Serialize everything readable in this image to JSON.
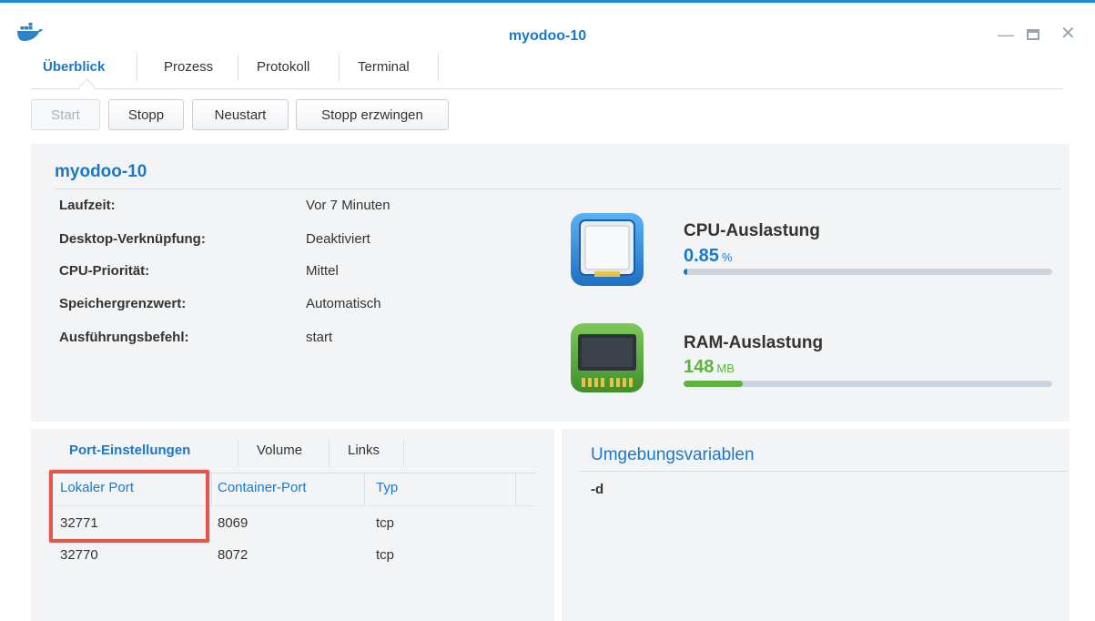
{
  "window": {
    "title": "myodoo-10",
    "app_icon": "docker-whale-icon",
    "controls": [
      "minimize-icon",
      "maximize-icon",
      "close-icon"
    ]
  },
  "tabs": [
    {
      "label": "Überblick",
      "active": true
    },
    {
      "label": "Prozess",
      "active": false
    },
    {
      "label": "Protokoll",
      "active": false
    },
    {
      "label": "Terminal",
      "active": false
    }
  ],
  "toolbar": {
    "start": "Start",
    "stop": "Stopp",
    "restart": "Neustart",
    "force_stop": "Stopp erzwingen"
  },
  "container": {
    "name": "myodoo-10",
    "details": [
      {
        "label": "Laufzeit:",
        "value": "Vor 7 Minuten"
      },
      {
        "label": "Desktop-Verknüpfung:",
        "value": "Deaktiviert"
      },
      {
        "label": "CPU-Priorität:",
        "value": "Mittel"
      },
      {
        "label": "Speichergrenzwert:",
        "value": "Automatisch"
      },
      {
        "label": "Ausführungsbefehl:",
        "value": "start"
      }
    ]
  },
  "metrics": {
    "cpu": {
      "title": "CPU-Auslastung",
      "value": "0.85",
      "unit": "%",
      "usage_fraction": 0.0085,
      "color": "#1b78c9"
    },
    "ram": {
      "title": "RAM-Auslastung",
      "value": "148",
      "unit": "MB",
      "usage_fraction": 0.16,
      "color": "#5cb33e"
    }
  },
  "ports": {
    "tabs": [
      {
        "label": "Port-Einstellungen",
        "active": true
      },
      {
        "label": "Volume",
        "active": false
      },
      {
        "label": "Links",
        "active": false
      }
    ],
    "columns": [
      "Lokaler Port",
      "Container-Port",
      "Typ"
    ],
    "rows": [
      {
        "local": "32771",
        "container": "8069",
        "type": "tcp"
      },
      {
        "local": "32770",
        "container": "8072",
        "type": "tcp"
      }
    ]
  },
  "environment": {
    "title": "Umgebungsvariablen",
    "items": [
      "-d"
    ]
  },
  "colors": {
    "accent": "#1b78c9",
    "highlight": "#e0574d",
    "panel": "#f2f4f6"
  }
}
